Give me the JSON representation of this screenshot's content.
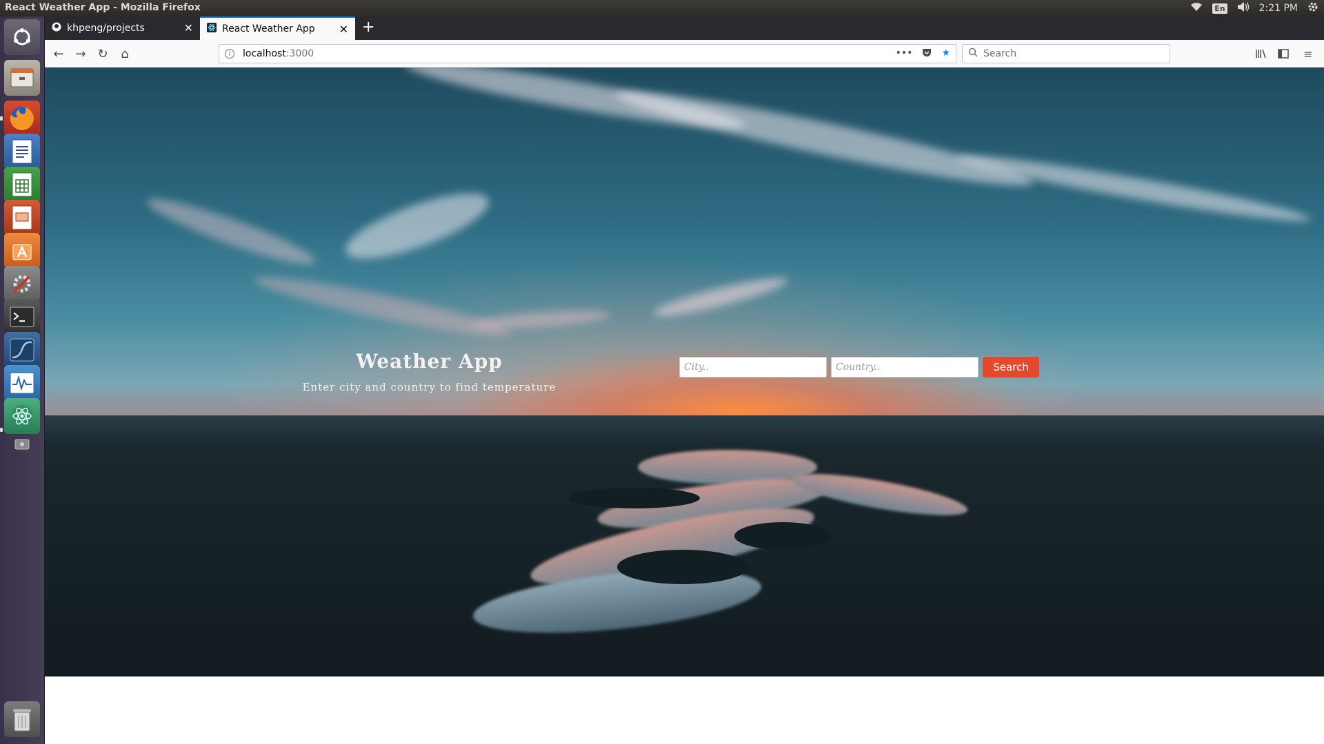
{
  "system": {
    "window_title": "React Weather App - Mozilla Firefox",
    "keyboard": "En",
    "clock": "2:21 PM"
  },
  "browser": {
    "tabs": [
      {
        "label": "khpeng/projects",
        "icon": "github-icon"
      },
      {
        "label": "React Weather App",
        "icon": "react-icon"
      }
    ],
    "url_host": "localhost",
    "url_port": ":3000",
    "search_placeholder": "Search"
  },
  "launcher": {
    "items": [
      "dash-icon",
      "files-icon",
      "firefox-icon",
      "writer-icon",
      "calc-icon",
      "impress-icon",
      "software-center-icon",
      "system-settings-icon",
      "terminal-icon",
      "monitor-icon",
      "system-monitor-icon",
      "atom-icon",
      "drive-icon",
      "trash-icon"
    ]
  },
  "app": {
    "title": "Weather App",
    "subtitle": "Enter city and country to find temperature",
    "city_placeholder": "City..",
    "country_placeholder": "Country..",
    "search_label": "Search"
  },
  "colors": {
    "accent": "#e24a2b",
    "tab_highlight": "#0a84ff"
  }
}
